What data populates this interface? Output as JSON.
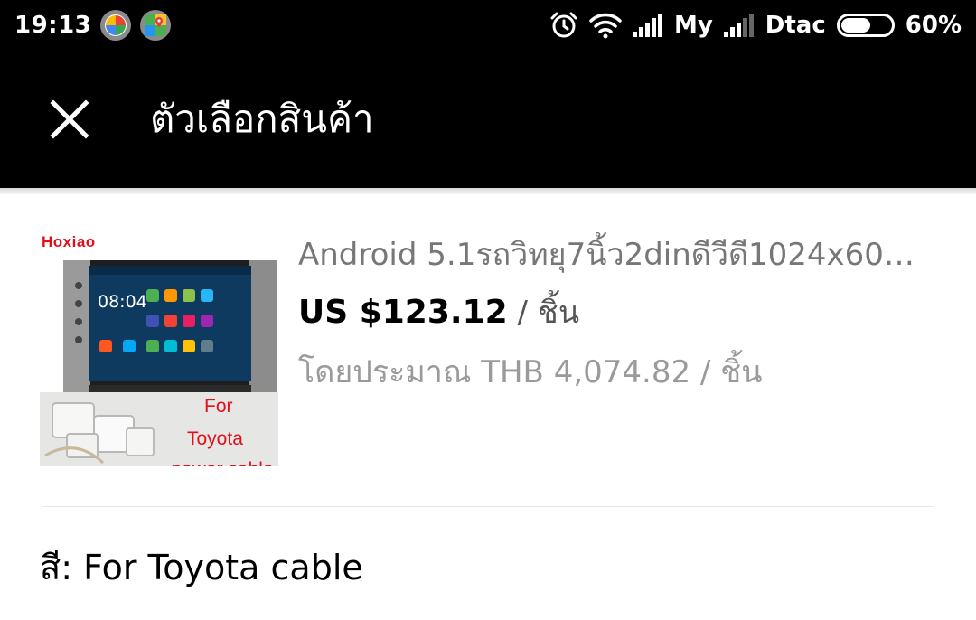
{
  "status_bar": {
    "time": "19:13",
    "carrier_1": "My",
    "carrier_2": "Dtac",
    "battery_percent": "60%",
    "battery_level": 0.6,
    "icons": [
      "photos-app-icon",
      "maps-app-icon",
      "alarm-icon",
      "wifi-icon",
      "signal-icon",
      "signal-icon",
      "battery-icon"
    ]
  },
  "header": {
    "title": "ตัวเลือกสินค้า",
    "close_icon": "close-icon"
  },
  "product": {
    "name": "Android 5.1รถวิทยุ7นิ้ว2dinดีวีดี1024x600...",
    "price": "US $123.12",
    "price_unit": " / ชิ้น",
    "approx_price": "โดยประมาณ THB 4,074.82 / ชิ้น",
    "image": {
      "brand": "Hoxiao",
      "screen_time": "08:04",
      "promo_line_1": "For",
      "promo_line_2": "Toyota",
      "promo_line_3": "power cable"
    }
  },
  "option": {
    "label": "สี: For Toyota cable"
  },
  "colors": {
    "bar_background": "#000000",
    "brand_red": "#e0111b",
    "muted_text": "#9a9a9a"
  }
}
